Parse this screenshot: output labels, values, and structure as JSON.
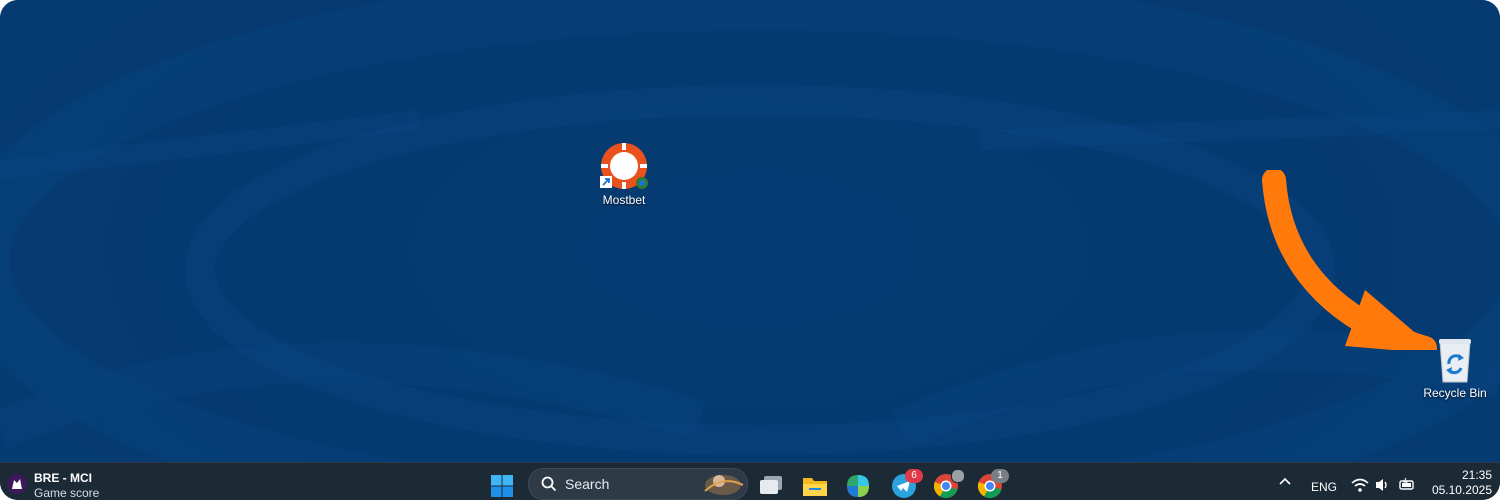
{
  "desktop": {
    "icons": [
      {
        "name": "mostbet-shortcut",
        "label": "Mostbet"
      },
      {
        "name": "recycle-bin",
        "label": "Recycle Bin"
      }
    ],
    "annotation_arrow_color": "#ff7a0b",
    "background_color": "#053a70"
  },
  "taskbar": {
    "widget": {
      "title": "BRE - MCI",
      "subtitle": "Game score"
    },
    "search": {
      "label": "Search"
    },
    "apps": [
      {
        "icon": "windows-start-icon"
      },
      {
        "icon": "search-icon"
      },
      {
        "icon": "task-view-icon"
      },
      {
        "icon": "file-explorer-icon"
      },
      {
        "icon": "office-app-icon"
      },
      {
        "icon": "telegram-icon",
        "badge": "6"
      },
      {
        "icon": "chrome-icon"
      },
      {
        "icon": "chrome-icon",
        "badge": "1"
      }
    ],
    "tray": {
      "language": "ENG",
      "clock_time": "21:35",
      "clock_date": "05.10.2025"
    }
  }
}
